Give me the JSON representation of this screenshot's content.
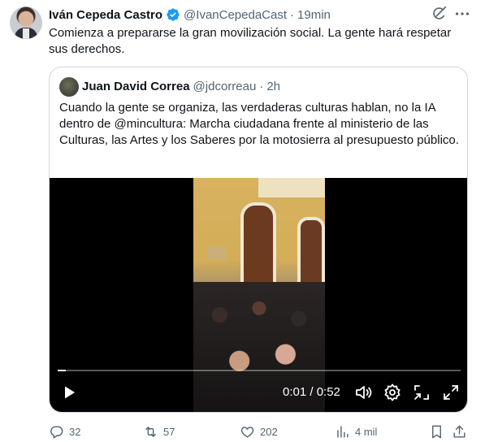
{
  "tweet": {
    "author_name": "Iván Cepeda Castro",
    "handle": "@IvanCepedaCast",
    "separator": "·",
    "time": "19min",
    "text": "Comienza a prepararse la gran movilización social. La gente hará respetar sus derechos."
  },
  "quote": {
    "author_name": "Juan David Correa",
    "handle": "@jdcorreau",
    "separator": "·",
    "time": "2h",
    "text": "Cuando la gente se organiza, las verdaderas culturas hablan, no la IA dentro de @mincultura: Marcha ciudadana frente al ministerio de las Culturas, las Artes y los Saberes por la motosierra al presupuesto público."
  },
  "video": {
    "current_time": "0:01",
    "duration": "0:52",
    "timecode": "0:01 / 0:52",
    "progress": 0.02
  },
  "actions": {
    "replies": "32",
    "reposts": "57",
    "likes": "202",
    "views": "4 mil"
  },
  "icons": [
    "verified-badge-icon",
    "grok-icon",
    "more-icon",
    "play-icon",
    "volume-icon",
    "settings-icon",
    "pip-icon",
    "fullscreen-icon",
    "reply-icon",
    "repost-icon",
    "like-icon",
    "views-icon",
    "bookmark-icon",
    "share-icon"
  ],
  "colors": {
    "verified": "#1d9bf0",
    "secondary_text": "#536471",
    "border": "#cfd9de"
  }
}
